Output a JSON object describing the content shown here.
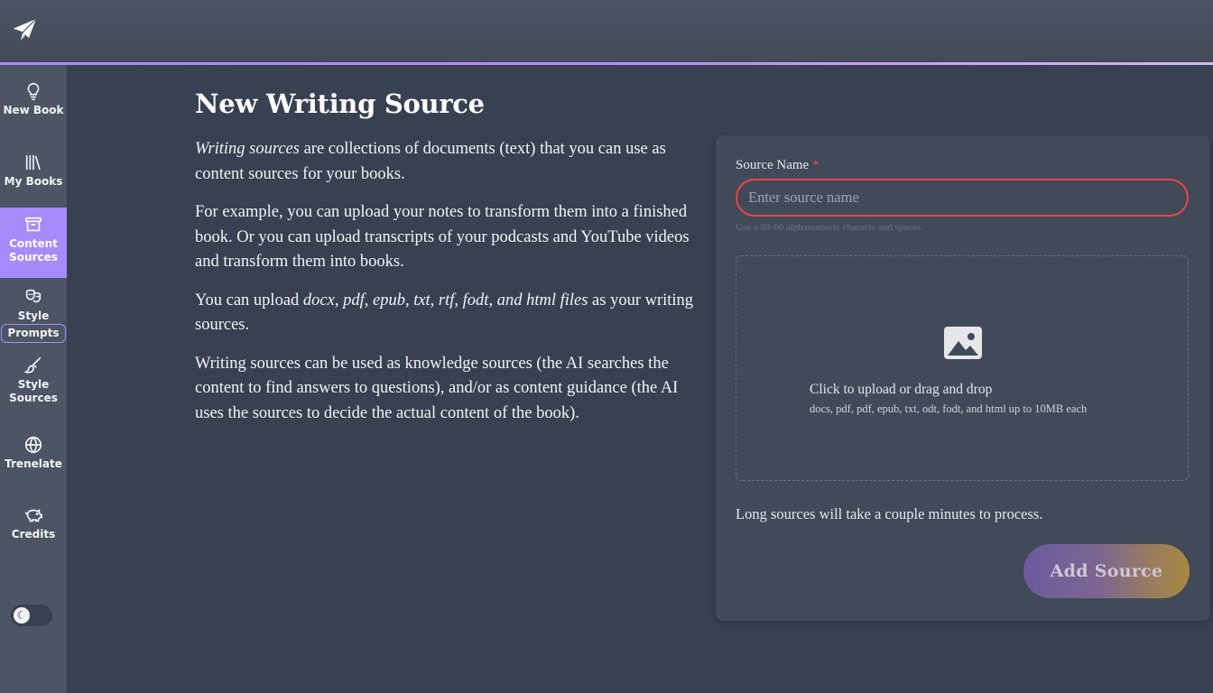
{
  "sidebar": {
    "items": [
      {
        "label": "New Book",
        "icon": "lightbulb-icon"
      },
      {
        "label": "My Books",
        "icon": "books-icon"
      },
      {
        "label": "Content Sources",
        "icon": "archive-box-icon",
        "active": true
      },
      {
        "label_top": "Style",
        "label_bottom": "Prompts",
        "icon": "theater-masks-icon"
      },
      {
        "label": "Style Sources",
        "icon": "paintbrush-icon"
      },
      {
        "label": "Trenelate",
        "icon": "globe-icon"
      },
      {
        "label": "Credits",
        "icon": "piggy-bank-icon"
      }
    ],
    "theme_toggle_icon": "moon-icon"
  },
  "main": {
    "title": "New Writing Source",
    "para1": {
      "em": "Writing sources",
      "rest": " are collections of documents (text) that you can use as content sources for your books."
    },
    "para2": "For example, you can upload your notes to transform them into a finished book. Or you can upload transcripts of your podcasts and YouTube videos and transform them into books.",
    "para3": {
      "before": "You can upload ",
      "em": "docx, pdf, epub, txt, rtf, fodt, and html files",
      "after": " as your writing sources."
    },
    "para4": "Writing sources can be used as knowledge sources (the AI searches the content to find answers to questions), and/or as content guidance (the AI uses the sources to decide the actual content of the book)."
  },
  "form": {
    "source_name_label": "Source Name",
    "required_mark": "*",
    "source_name_placeholder": "Enter source name",
    "source_name_value": "",
    "hint": "Use a 80-60 alphanumeric characte and spaces.",
    "upload_title": "Click to upload or drag and drop",
    "upload_subtitle": "docs, pdf, pdf, epub, txt, odt, fodt, and html up to 10MB each",
    "upload_icon": "image-icon",
    "process_note": "Long sources will take a couple minutes to process.",
    "submit_label": "Add Source"
  },
  "colors": {
    "accent": "#a78bfa",
    "error": "#ef4444",
    "background": "#374151"
  }
}
